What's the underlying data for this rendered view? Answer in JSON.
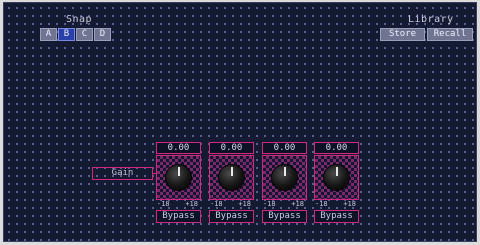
{
  "snap": {
    "title": "Snap",
    "buttons": [
      {
        "label": "A",
        "active": false
      },
      {
        "label": "B",
        "active": true
      },
      {
        "label": "C",
        "active": false
      },
      {
        "label": "D",
        "active": false
      }
    ]
  },
  "library": {
    "title": "Library",
    "store_label": "Store",
    "recall_label": "Recall"
  },
  "gain_label": "Gain",
  "channels": [
    {
      "value": "0.00",
      "min_label": "-18",
      "max_label": "+18",
      "bypass_label": "Bypass"
    },
    {
      "value": "0.00",
      "min_label": "-18",
      "max_label": "+18",
      "bypass_label": "Bypass"
    },
    {
      "value": "0.00",
      "min_label": "-18",
      "max_label": "+18",
      "bypass_label": "Bypass"
    },
    {
      "value": "0.00",
      "min_label": "-18",
      "max_label": "+18",
      "bypass_label": "Bypass"
    }
  ],
  "colors": {
    "background": "#151a33",
    "accent_border": "#d0287f",
    "active_button": "#2940a8",
    "button": "#6f7591"
  }
}
